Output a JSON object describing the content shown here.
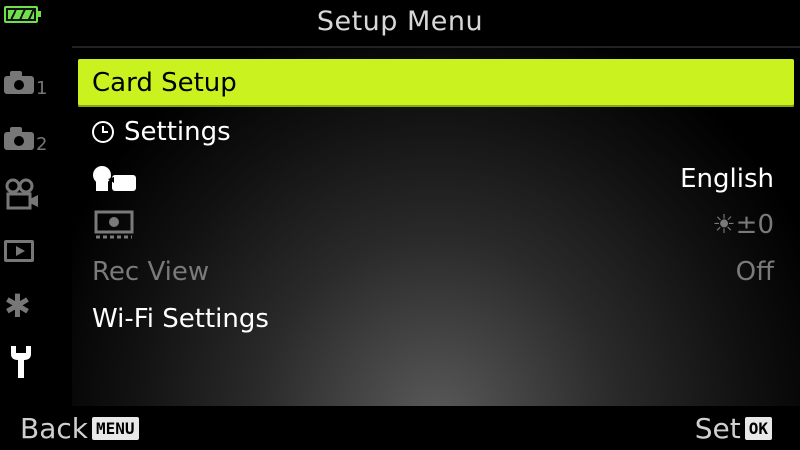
{
  "header": {
    "title": "Setup Menu",
    "battery_icon": "battery-full-icon"
  },
  "sidebar": {
    "items": [
      {
        "icon": "camera-icon",
        "sub": "1"
      },
      {
        "icon": "camera-icon",
        "sub": "2"
      },
      {
        "icon": "movie-camera-icon"
      },
      {
        "icon": "playback-icon"
      },
      {
        "icon": "gear-icon"
      },
      {
        "icon": "wrench-icon"
      }
    ]
  },
  "menu": {
    "items": [
      {
        "label": "Card Setup",
        "value": "",
        "selected": true
      },
      {
        "label": "Settings",
        "value": "",
        "icon": "clock-icon"
      },
      {
        "label": "",
        "value": "English",
        "icon": "language-speech-icon"
      },
      {
        "label": "",
        "value": "☀±0",
        "icon": "monitor-brightness-icon",
        "dimmed": true
      },
      {
        "label": "Rec View",
        "value": "Off",
        "dimmed": true
      },
      {
        "label": "Wi-Fi Settings",
        "value": ""
      }
    ]
  },
  "footer": {
    "back_label": "Back",
    "back_key": "MENU",
    "set_label": "Set",
    "set_key": "OK"
  },
  "colors": {
    "highlight": "#c9f21f",
    "battery": "#6fe04a",
    "dim_text": "#7a7a7a"
  }
}
